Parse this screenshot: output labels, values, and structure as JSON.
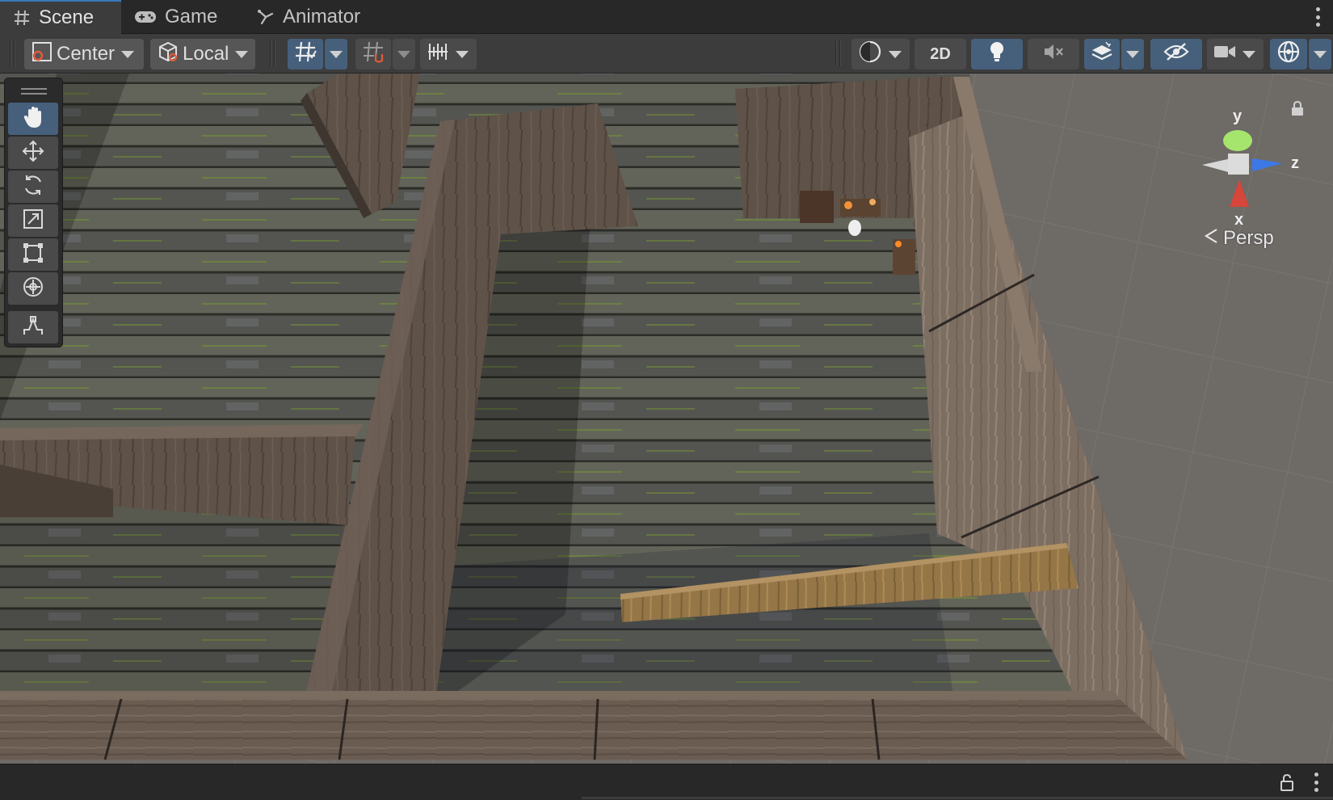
{
  "tabs": [
    {
      "label": "Scene",
      "icon": "hash-icon",
      "active": true
    },
    {
      "label": "Game",
      "icon": "gamepad-icon",
      "active": false
    },
    {
      "label": "Animator",
      "icon": "animator-icon",
      "active": false
    }
  ],
  "toolbar": {
    "pivot_label": "Center",
    "space_label": "Local",
    "mode_2d_label": "2D"
  },
  "gizmo": {
    "y_label": "y",
    "z_label": "z",
    "x_label": "x",
    "projection_label": "Persp"
  },
  "colors": {
    "accent": "#46607c",
    "axis_x": "#d6463a",
    "axis_y": "#9be36a",
    "axis_z": "#3d79e6",
    "background": "#6e6a66"
  }
}
